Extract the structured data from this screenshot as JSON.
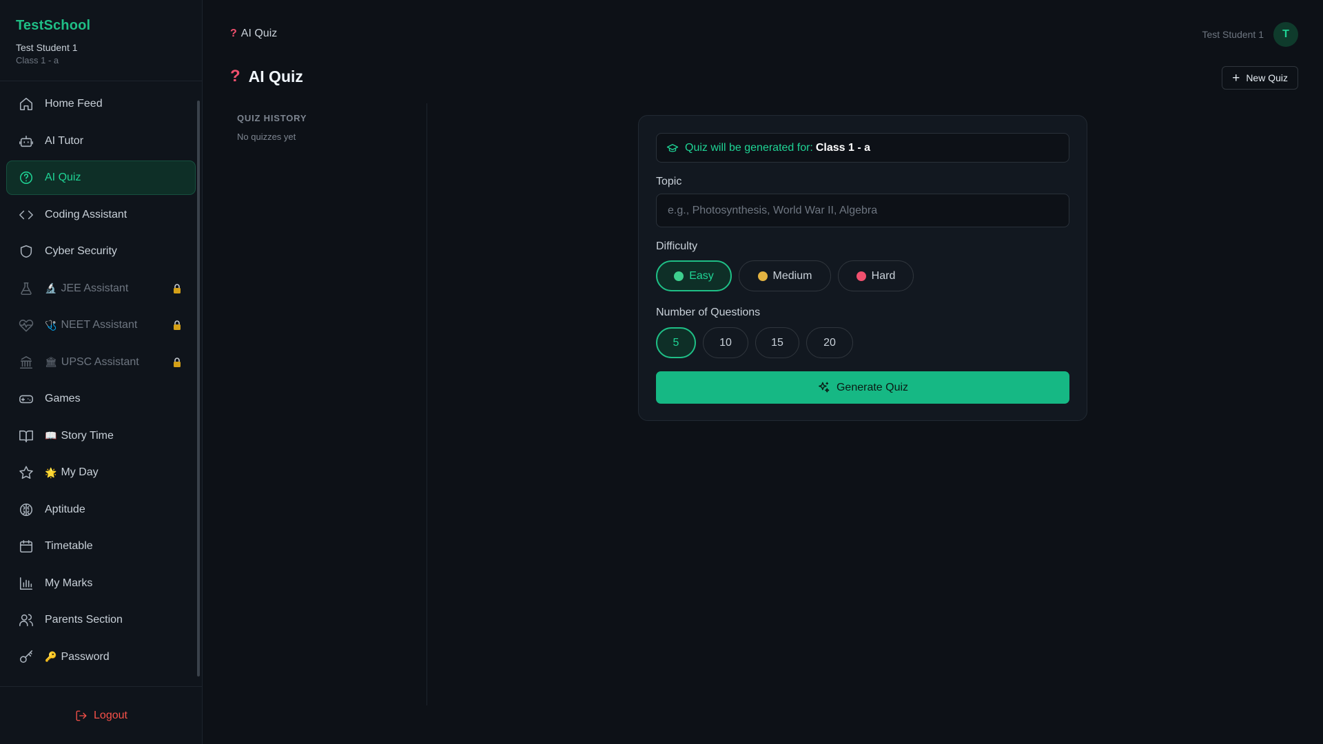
{
  "brand": {
    "name": "TestSchool",
    "user": "Test Student 1",
    "class": "Class 1 - a"
  },
  "sidebar": {
    "items": [
      {
        "label": "Home Feed",
        "emoji": "",
        "icon": "home-icon",
        "active": false,
        "locked": false
      },
      {
        "label": "AI Tutor",
        "emoji": "",
        "icon": "robot-icon",
        "active": false,
        "locked": false
      },
      {
        "label": "AI Quiz",
        "emoji": "",
        "icon": "help-circle-icon",
        "active": true,
        "locked": false
      },
      {
        "label": "Coding Assistant",
        "emoji": "",
        "icon": "code-icon",
        "active": false,
        "locked": false
      },
      {
        "label": "Cyber Security",
        "emoji": "",
        "icon": "shield-icon",
        "active": false,
        "locked": false
      },
      {
        "label": "JEE Assistant",
        "emoji": "🔬",
        "icon": "flask-icon",
        "active": false,
        "locked": true
      },
      {
        "label": "NEET Assistant",
        "emoji": "🩺",
        "icon": "heart-pulse-icon",
        "active": false,
        "locked": true
      },
      {
        "label": "UPSC Assistant",
        "emoji": "🏛",
        "icon": "landmark-icon",
        "active": false,
        "locked": true
      },
      {
        "label": "Games",
        "emoji": "",
        "icon": "gamepad-icon",
        "active": false,
        "locked": false
      },
      {
        "label": "Story Time",
        "emoji": "📖",
        "icon": "book-open-icon",
        "active": false,
        "locked": false
      },
      {
        "label": "My Day",
        "emoji": "🌟",
        "icon": "star-icon",
        "active": false,
        "locked": false
      },
      {
        "label": "Aptitude",
        "emoji": "",
        "icon": "brain-icon",
        "active": false,
        "locked": false
      },
      {
        "label": "Timetable",
        "emoji": "",
        "icon": "calendar-icon",
        "active": false,
        "locked": false
      },
      {
        "label": "My Marks",
        "emoji": "",
        "icon": "bar-chart-icon",
        "active": false,
        "locked": false
      },
      {
        "label": "Parents Section",
        "emoji": "",
        "icon": "users-icon",
        "active": false,
        "locked": false
      },
      {
        "label": "Password",
        "emoji": "🔑",
        "icon": "key-icon",
        "active": false,
        "locked": false
      }
    ],
    "logout_label": "Logout"
  },
  "header": {
    "breadcrumb": "AI Quiz",
    "user_name": "Test Student 1",
    "avatar_initial": "T",
    "page_title": "AI Quiz",
    "new_quiz_label": "New Quiz",
    "title_glyph": "?"
  },
  "history": {
    "title": "QUIZ HISTORY",
    "empty_text": "No quizzes yet"
  },
  "quiz": {
    "banner_label": "Quiz will be generated for:",
    "banner_class": "Class 1 - a",
    "topic_label": "Topic",
    "topic_placeholder": "e.g., Photosynthesis, World War II, Algebra",
    "topic_value": "",
    "difficulty_label": "Difficulty",
    "difficulties": [
      {
        "label": "Easy",
        "color": "#3ecf8e",
        "selected": true
      },
      {
        "label": "Medium",
        "color": "#e3b341",
        "selected": false
      },
      {
        "label": "Hard",
        "color": "#f0506e",
        "selected": false
      }
    ],
    "questions_label": "Number of Questions",
    "question_counts": [
      {
        "label": "5",
        "selected": true
      },
      {
        "label": "10",
        "selected": false
      },
      {
        "label": "15",
        "selected": false
      },
      {
        "label": "20",
        "selected": false
      }
    ],
    "generate_label": "Generate Quiz"
  },
  "colors": {
    "accent": "#1fbf86",
    "danger": "#f85149",
    "background": "#0d1117"
  }
}
